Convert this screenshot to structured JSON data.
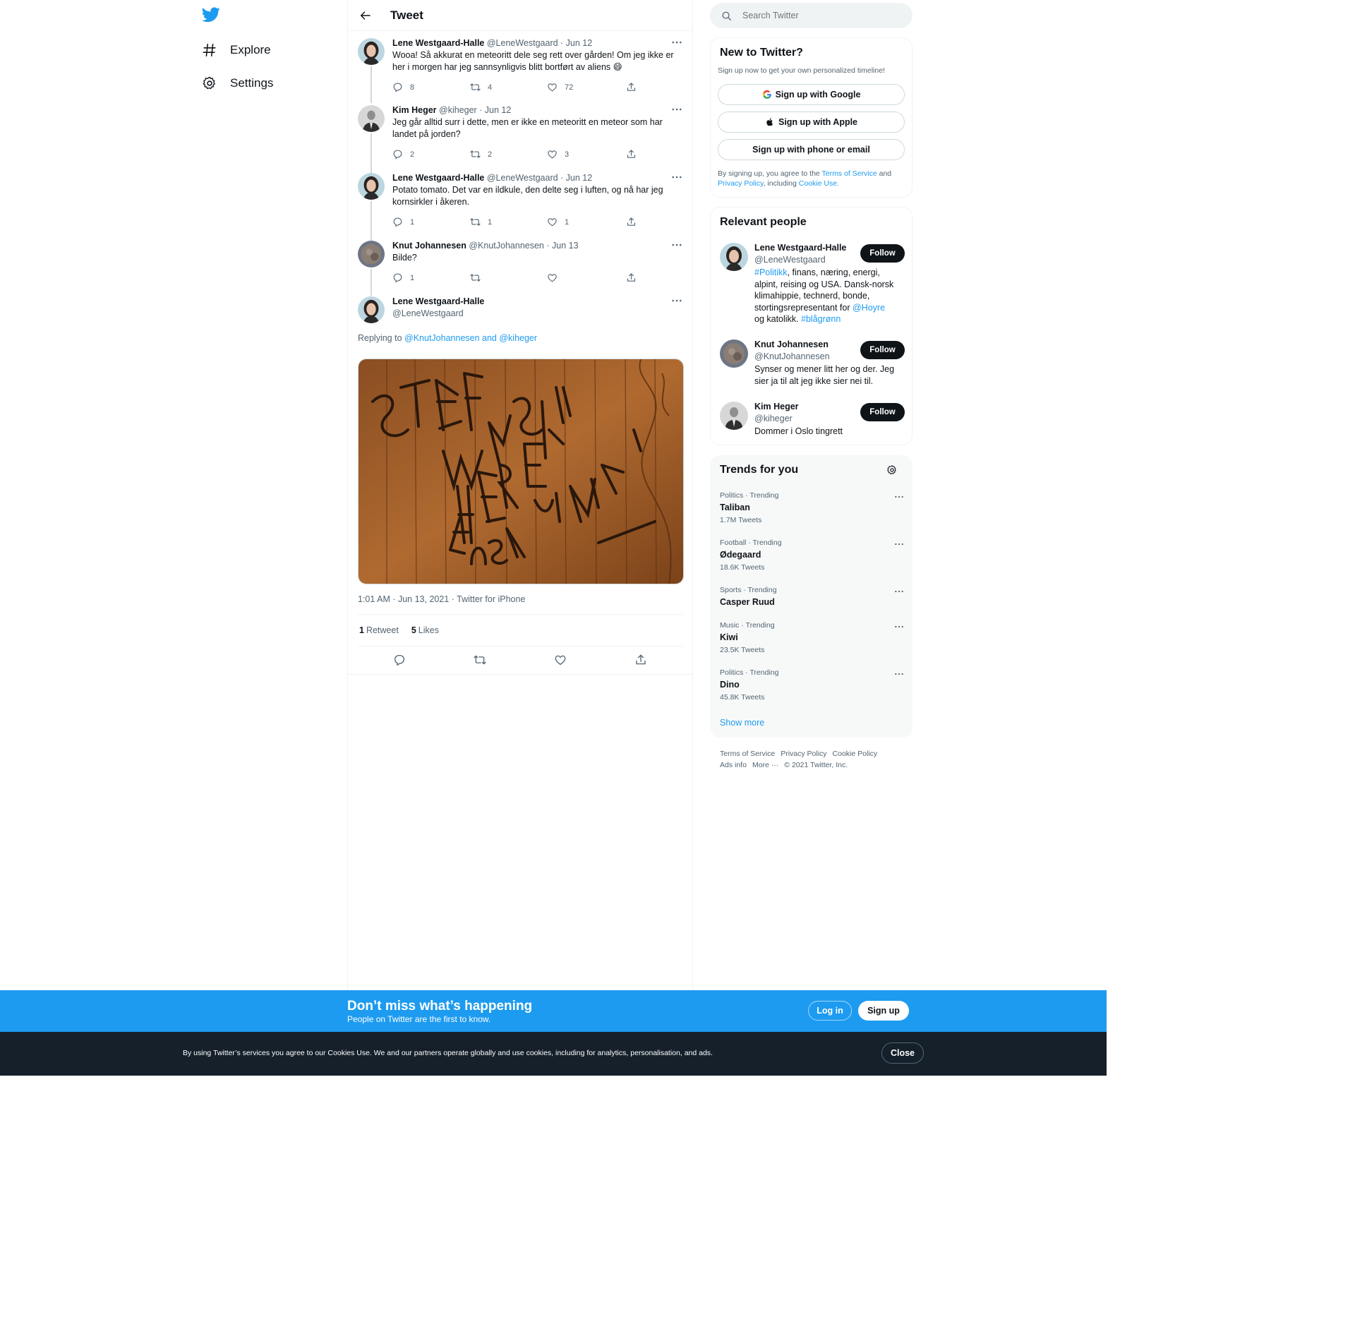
{
  "nav": {
    "explore": "Explore",
    "settings": "Settings"
  },
  "header": {
    "title": "Tweet"
  },
  "thread": [
    {
      "name": "Lene Westgaard-Halle",
      "meta": "@LeneWestgaard · Jun 12",
      "text": "Wooa! Så akkurat en meteoritt dele seg rett over gården! Om jeg ikke er her i morgen har jeg sannsynligvis blitt bortført av aliens 😄",
      "replies": "8",
      "retweets": "4",
      "likes": "72"
    },
    {
      "name": "Kim Heger",
      "meta": "@kiheger · Jun 12",
      "text": "Jeg går alltid surr i dette, men er ikke en meteoritt en meteor som har landet på jorden?",
      "replies": "2",
      "retweets": "2",
      "likes": "3"
    },
    {
      "name": "Lene Westgaard-Halle",
      "meta": "@LeneWestgaard · Jun 12",
      "text": "Potato tomato. Det var en ildkule, den delte seg i luften, og nå har jeg kornsirkler i åkeren.",
      "replies": "1",
      "retweets": "1",
      "likes": "1"
    },
    {
      "name": "Knut Johannesen",
      "meta": "@KnutJohannesen · Jun 13",
      "text": "Bilde?",
      "replies": "1",
      "retweets": "",
      "likes": ""
    }
  ],
  "main_tweet": {
    "name": "Lene Westgaard-Halle",
    "handle": "@LeneWestgaard",
    "replying_prefix": "Replying to",
    "replying_to": "@KnutJohannesen and @kiheger",
    "timestamp": "1:01 AM · Jun 13, 2021 · Twitter for iPhone",
    "retweet_count": "1",
    "retweet_label": "Retweet",
    "like_count": "5",
    "like_label": "Likes"
  },
  "search": {
    "placeholder": "Search Twitter"
  },
  "new_to_twitter": {
    "title": "New to Twitter?",
    "subtitle": "Sign up now to get your own personalized timeline!",
    "google": "Sign up with Google",
    "apple": "Sign up with Apple",
    "phone": "Sign up with phone or email",
    "legal_1": "By signing up, you agree to the",
    "terms": "Terms of Service",
    "legal_2": "and",
    "privacy": "Privacy Policy",
    "legal_3": ", including",
    "cookie": "Cookie Use."
  },
  "relevant_people": {
    "title": "Relevant people",
    "follow_label": "Follow",
    "people": [
      {
        "name": "Lene Westgaard-Halle",
        "handle": "@LeneWestgaard",
        "bio_tag1": "#Politikk",
        "bio_text1": ", finans, næring, energi, alpint, reising og USA. Dansk-norsk klimahippie, technerd, bonde, stortingsrepresentant for",
        "bio_mention": "@Hoyre",
        "bio_text2": "og katolikk.",
        "bio_tag2": "#blågrønn"
      },
      {
        "name": "Knut Johannesen",
        "handle": "@KnutJohannesen",
        "bio": "Synser og mener litt her og der. Jeg sier ja til alt jeg ikke sier nei til."
      },
      {
        "name": "Kim Heger",
        "handle": "@kiheger",
        "bio": "Dommer i Oslo tingrett"
      }
    ]
  },
  "trends": {
    "title": "Trends for you",
    "items": [
      {
        "category": "Politics · Trending",
        "name": "Taliban",
        "count": "1.7M Tweets"
      },
      {
        "category": "Football · Trending",
        "name": "Ødegaard",
        "count": "18.6K Tweets"
      },
      {
        "category": "Sports · Trending",
        "name": "Casper Ruud",
        "count": ""
      },
      {
        "category": "Music · Trending",
        "name": "Kiwi",
        "count": "23.5K Tweets"
      },
      {
        "category": "Politics · Trending",
        "name": "Dino",
        "count": "45.8K Tweets"
      }
    ],
    "show_more": "Show more"
  },
  "footer": {
    "terms": "Terms of Service",
    "privacy": "Privacy Policy",
    "cookie": "Cookie Policy",
    "ads": "Ads info",
    "more": "More ···",
    "copyright": "© 2021 Twitter, Inc."
  },
  "banner": {
    "title": "Don’t miss what’s happening",
    "subtitle": "People on Twitter are the first to know.",
    "login": "Log in",
    "signup": "Sign up"
  },
  "cookie_bar": {
    "text": "By using Twitter’s services you agree to our Cookies Use. We and our partners operate globally and use cookies, including for analytics, personalisation, and ads.",
    "close": "Close"
  },
  "colors": {
    "accent": "#1d9bf0",
    "text": "#0f1419",
    "muted": "#536471",
    "dark_bar": "#15202b"
  },
  "icons": {
    "logo": "twitter-bird-icon",
    "explore": "hashtag-icon",
    "settings": "gear-icon",
    "back": "arrow-left-icon",
    "reply": "reply-icon",
    "retweet": "retweet-icon",
    "like": "heart-icon",
    "share": "share-icon",
    "more": "more-dots-icon",
    "search": "search-icon"
  }
}
